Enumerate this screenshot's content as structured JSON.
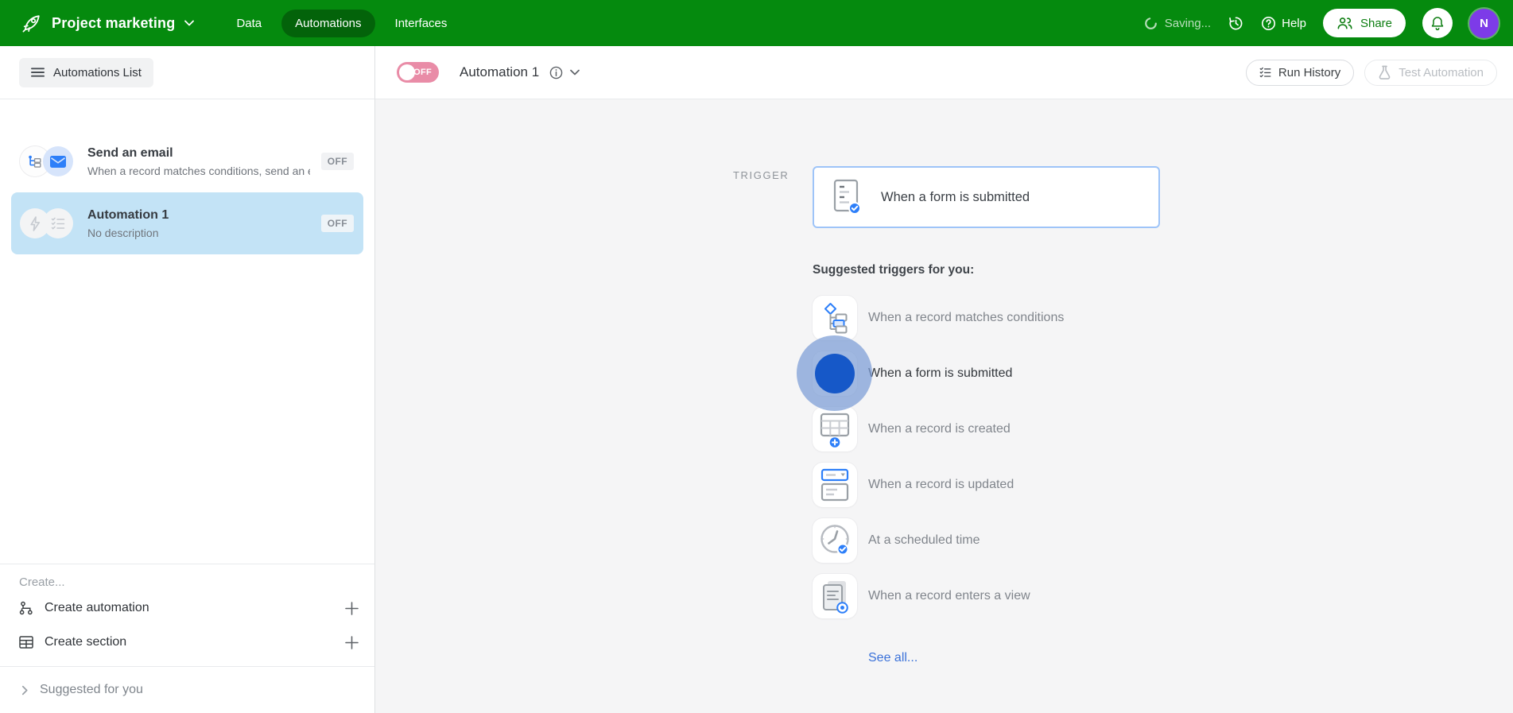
{
  "colors": {
    "topbar_green": "#058a0e",
    "accent_blue": "#2d7ff9",
    "selected_item_blue": "#c3e3f6",
    "toggle_off_pink": "#e98ca7",
    "avatar_purple": "#7d3be8",
    "see_all_link_blue": "#3b72d9"
  },
  "topbar": {
    "app_title": "Project marketing",
    "tabs": [
      {
        "label": "Data",
        "active": false
      },
      {
        "label": "Automations",
        "active": true
      },
      {
        "label": "Interfaces",
        "active": false
      }
    ],
    "saving_status": "Saving...",
    "help_label": "Help",
    "share_label": "Share",
    "avatar_initial": "N"
  },
  "sidebar": {
    "header_button": "Automations List",
    "items": [
      {
        "title": "Send an email",
        "description": "When a record matches conditions, send an em...",
        "status": "OFF",
        "selected": false,
        "icons": [
          "branch-icon",
          "envelope-icon"
        ]
      },
      {
        "title": "Automation 1",
        "description": "No description",
        "status": "OFF",
        "selected": true,
        "icons": [
          "lightning-icon",
          "checklist-icon"
        ]
      }
    ],
    "create_label": "Create...",
    "create_actions": [
      {
        "label": "Create automation",
        "icon": "automation-flow-icon"
      },
      {
        "label": "Create section",
        "icon": "table-icon"
      }
    ],
    "suggested_label": "Suggested for you"
  },
  "header": {
    "toggle_state": "OFF",
    "automation_title": "Automation 1",
    "run_history_label": "Run History",
    "test_automation_label": "Test Automation"
  },
  "canvas": {
    "trigger_label": "TRIGGER",
    "trigger_card_title": "When a form is submitted",
    "suggested_heading": "Suggested triggers for you:",
    "suggested_triggers": [
      {
        "label": "When a record matches conditions",
        "icon": "flowchart-icon",
        "hovered": false
      },
      {
        "label": "When a form is submitted",
        "icon": "form-submitted-icon",
        "hovered": true
      },
      {
        "label": "When a record is created",
        "icon": "table-plus-icon",
        "hovered": false
      },
      {
        "label": "When a record is updated",
        "icon": "record-updated-icon",
        "hovered": false
      },
      {
        "label": "At a scheduled time",
        "icon": "clock-check-icon",
        "hovered": false
      },
      {
        "label": "When a record enters a view",
        "icon": "view-enter-icon",
        "hovered": false
      }
    ],
    "see_all_label": "See all..."
  }
}
